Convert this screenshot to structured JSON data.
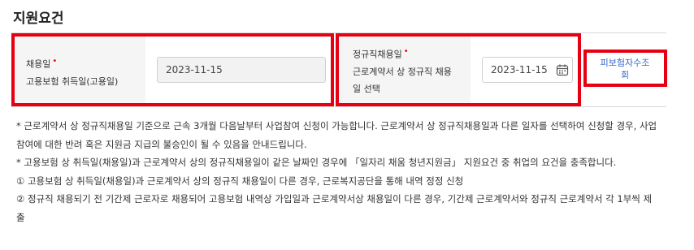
{
  "section": {
    "title": "지원요건"
  },
  "form": {
    "hire_date": {
      "label_line1": "채용일",
      "label_line2": "고용보험 취득일(고용일)",
      "required_mark": "•",
      "value": "2023-11-15"
    },
    "permanent_date": {
      "label_line1": "정규직채용일",
      "label_line2": "근로계약서 상 정규직 채용",
      "label_line3": "일 선택",
      "required_mark": "•",
      "value": "2023-11-15",
      "icon": "calendar-icon"
    },
    "insured_lookup_button": {
      "label_line1": "피보험자수조",
      "label_line2": "회"
    }
  },
  "notes": [
    "* 근로계약서 상 정규직채용일 기준으로 근속 3개월 다음날부터 사업참여 신청이 가능합니다. 근로계약서 상 정규직채용일과 다른 일자를 선택하여 신청할 경우, 사업참여에 대한 반려 혹은 지원금 지급의 불승인이 될 수 있음을 안내드립니다.",
    "* 고용보험 상 취득일(채용일)과 근로계약서 상의 정규직채용일이 같은 날짜인 경우에 「일자리 채움 청년지원금」 지원요건 중 취업의 요건을 충족합니다.",
    "① 고용보험 상 취득일(채용일)과 근로계약서 상의 정규직 채용일이 다른 경우, 근로복지공단을 통해 내역 정정 신청",
    "② 정규직 채용되기 전 기간제 근로자로 채용되어 고용보험 내역상 가입일과 근로계약서상 채용일이 다른 경우, 기간제 근로계약서와 정규직 근로계약서 각 1부씩 제출"
  ],
  "colors": {
    "highlight": "#e60012",
    "link": "#3366cc",
    "label_bg": "#f5f5f5"
  }
}
